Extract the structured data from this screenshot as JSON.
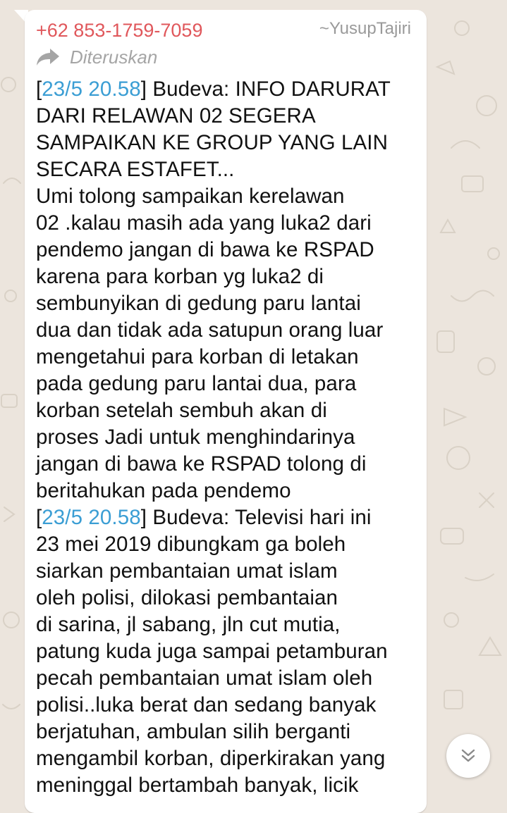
{
  "colors": {
    "wallpaper": "#ece5dd",
    "bubble": "#ffffff",
    "sender_phone": "#e0575b",
    "sender_name": "#9a9a9a",
    "forwarded": "#a5a5a5",
    "timestamp_link": "#3b9ed4",
    "text": "#111111"
  },
  "message": {
    "sender_phone": "+62 853-1759-7059",
    "sender_name": "~YusupTajiri",
    "forwarded_icon": "forward-arrow-icon",
    "forwarded_label": "Diteruskan",
    "lines": [
      {
        "open": "[",
        "ts": "23/5 20.58",
        "text": "] Budeva: INFO DARURAT"
      },
      {
        "text": "DARI RELAWAN 02 SEGERA"
      },
      {
        "text": "SAMPAIKAN KE GROUP YANG LAIN"
      },
      {
        "text": "SECARA ESTAFET..."
      },
      {
        "text": "Umi tolong sampaikan kerelawan"
      },
      {
        "text": "02 .kalau masih ada yang luka2 dari"
      },
      {
        "text": "pendemo jangan di bawa ke RSPAD"
      },
      {
        "text": "karena para korban yg luka2 di"
      },
      {
        "text": "sembunyikan di gedung paru lantai"
      },
      {
        "text": "dua dan tidak ada satupun orang luar"
      },
      {
        "text": "mengetahui para korban di letakan"
      },
      {
        "text": "pada gedung paru lantai dua, para"
      },
      {
        "text": "korban setelah sembuh akan di"
      },
      {
        "text": "proses Jadi untuk menghindarinya"
      },
      {
        "text": "jangan di bawa ke RSPAD tolong di"
      },
      {
        "text": "beritahukan pada pendemo"
      },
      {
        "open": "[",
        "ts": "23/5 20.58",
        "text": "] Budeva: Televisi hari ini"
      },
      {
        "text": "23 mei 2019 dibungkam ga boleh"
      },
      {
        "text": "siarkan pembantaian umat islam"
      },
      {
        "text": "oleh polisi, dilokasi pembantaian"
      },
      {
        "text": "di sarina, jl sabang, jln cut mutia,"
      },
      {
        "text": "patung kuda juga sampai petamburan"
      },
      {
        "text": "pecah pembantaian umat islam oleh"
      },
      {
        "text": "polisi..luka berat dan sedang banyak"
      },
      {
        "text": "berjatuhan, ambulan silih berganti"
      },
      {
        "text": "mengambil korban, diperkirakan yang"
      },
      {
        "text": "meninggal bertambah banyak, licik"
      }
    ]
  },
  "scroll_button": {
    "icon": "double-chevron-down-icon"
  }
}
